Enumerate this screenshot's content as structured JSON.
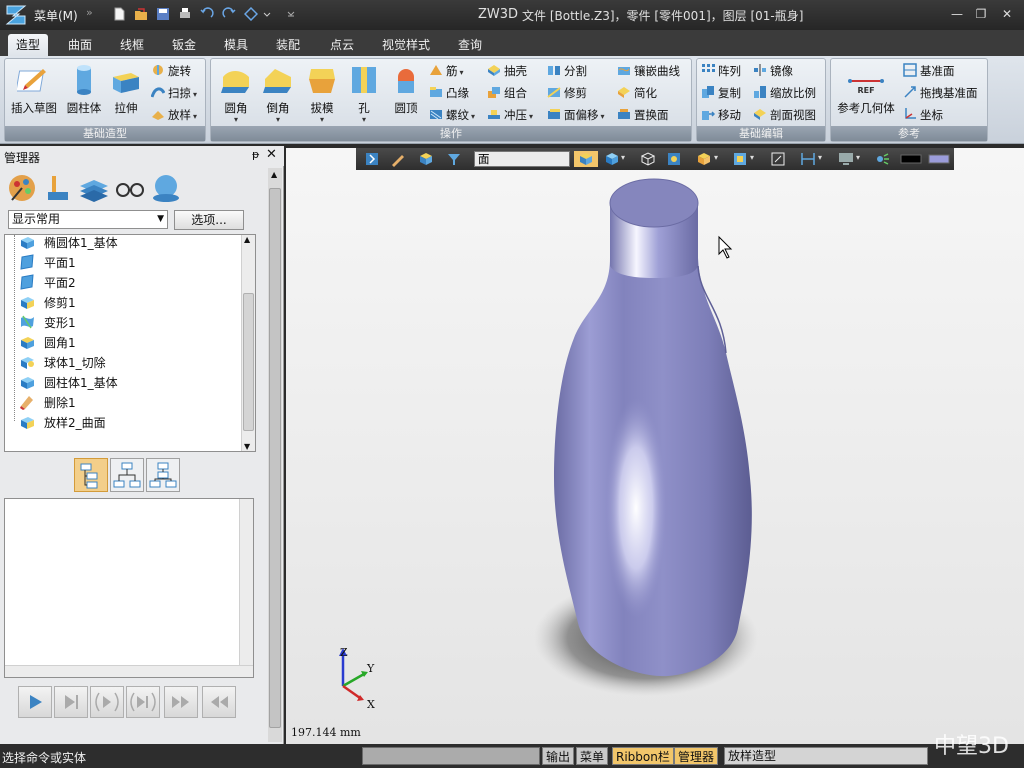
{
  "titlebar": {
    "menu_label": "菜单(M)",
    "menu_arrow": "»",
    "app_name": "ZW3D",
    "document": "文件 [Bottle.Z3]，零件 [零件001]，图层 [01-瓶身]"
  },
  "tabs": [
    "造型",
    "曲面",
    "线框",
    "钣金",
    "模具",
    "装配",
    "点云",
    "视觉样式",
    "查询"
  ],
  "ribbon": {
    "group1": {
      "label": "基础造型",
      "big": [
        "插入草图",
        "圆柱体",
        "拉伸"
      ],
      "small": [
        "旋转",
        "扫掠",
        "放样"
      ]
    },
    "group2": {
      "label": "操作",
      "big": [
        "圆角",
        "倒角",
        "拔模",
        "孔",
        "圆顶"
      ],
      "small_col1": [
        "筋",
        "凸缘",
        "螺纹"
      ],
      "small_col2": [
        "抽壳",
        "组合",
        "冲压"
      ],
      "small_col3": [
        "分割",
        "修剪",
        "面偏移"
      ],
      "small_col4": [
        "镶嵌曲线",
        "简化",
        "置换面"
      ]
    },
    "group3": {
      "label": "基础编辑",
      "small_col1": [
        "阵列",
        "复制",
        "移动"
      ],
      "small_col2": [
        "镜像",
        "缩放比例",
        "剖面视图"
      ]
    },
    "group4": {
      "label": "参考",
      "ref_badge": "REF",
      "big": "参考几何体",
      "small": [
        "基准面",
        "拖拽基准面",
        "坐标"
      ]
    }
  },
  "manager": {
    "title": "管理器",
    "pin": "ᵽ",
    "close": "✕",
    "filter_value": "显示常用",
    "options_label": "选项...",
    "tree": [
      "椭圆体1_基体",
      "平面1",
      "平面2",
      "修剪1",
      "变形1",
      "圆角1",
      "球体1_切除",
      "圆柱体1_基体",
      "删除1",
      "放样2_曲面"
    ]
  },
  "viewport": {
    "filter_value": "面",
    "scale": "197.144 mm",
    "axis": {
      "z": "Z",
      "y": "Y",
      "x": "X"
    }
  },
  "statusbar": {
    "prompt": "选择命令或实体",
    "tabs": [
      "输出",
      "菜单",
      "Ribbon栏",
      "管理器"
    ],
    "command": "放样造型"
  },
  "watermark": "中望3D",
  "colors": {
    "bottle": "#8e8fc4",
    "active_tab": "#f2c66a",
    "titlebar": "#2b2b2b"
  }
}
